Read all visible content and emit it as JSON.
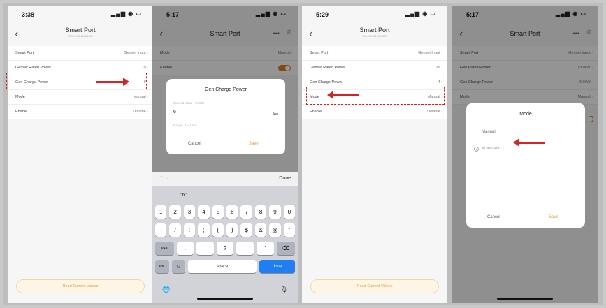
{
  "colors": {
    "accent": "#e07f1f",
    "annotation": "#d42424",
    "done_key": "#1e7ef2"
  },
  "p1": {
    "time": "3:38",
    "status_icons": "▂▄▆ ◉ ▭",
    "title": "Smart Port",
    "subtitle": "SN-4194041005605",
    "rows": [
      {
        "label": "Smart Port",
        "value": "Genset Input"
      },
      {
        "label": "Genset Rated Power",
        "value": "0"
      },
      {
        "label": "Gen Charge Power",
        "value": "0"
      },
      {
        "label": "Mode",
        "value": "Manual"
      },
      {
        "label": "Enable",
        "value": "Disable"
      }
    ],
    "footer": "Read Current Values"
  },
  "p2": {
    "time": "5:17",
    "status_icons": "▂▄▆ ◉ ▭",
    "title": "Smart Port",
    "more": "•••",
    "close": "⊗",
    "bg_rows": [
      {
        "label": "Mode",
        "value": "Manual"
      },
      {
        "label": "Enable",
        "value": ""
      }
    ],
    "dialog": {
      "title": "Gen Charge Power",
      "current": "Current Value - 0.0kW",
      "input": "6",
      "unit": "kw",
      "range": "Range: 0 ~ 16kw",
      "cancel": "Cancel",
      "save": "Save"
    },
    "keyboard": {
      "done": "Done",
      "suggestion": "\"6\"",
      "row1": [
        "1",
        "2",
        "3",
        "4",
        "5",
        "6",
        "7",
        "8",
        "9",
        "0"
      ],
      "row2": [
        "-",
        "/",
        ":",
        ";",
        "(",
        ")",
        "$",
        "&",
        "@",
        "\""
      ],
      "row3_left": "#+=",
      "row3": [
        ".",
        ",",
        "?",
        "!",
        "'"
      ],
      "backspace": "⌫",
      "abc": "ABC",
      "emoji": "☺",
      "space": "space",
      "done_key": "done",
      "globe": "🌐",
      "mic": "🎙"
    }
  },
  "p3": {
    "time": "5:29",
    "status_icons": "▂▄▆ ◉ ▭",
    "title": "Smart Port",
    "subtitle": "SN-4194041005605",
    "rows": [
      {
        "label": "Smart Port",
        "value": "Genset Input"
      },
      {
        "label": "Genset Rated Power",
        "value": "26"
      },
      {
        "label": "Gen Charge Power",
        "value": "4"
      },
      {
        "label": "Mode",
        "value": "Manual"
      },
      {
        "label": "Enable",
        "value": "Disable"
      }
    ],
    "footer": "Read Current Values"
  },
  "p4": {
    "time": "5:17",
    "status_icons": "▂▄▆ ◉ ▭",
    "title": "Smart Port",
    "more": "•••",
    "close": "⊗",
    "bg_rows": [
      {
        "label": "Smart Port",
        "value": "Genset Input"
      },
      {
        "label": "Gen Rated Power",
        "value": "13.0kW"
      },
      {
        "label": "Gen Charge Power",
        "value": "6.0kW"
      },
      {
        "label": "Mode",
        "value": "Manual"
      }
    ],
    "dialog": {
      "title": "Mode",
      "options": [
        "Manual",
        "Automatic"
      ],
      "cancel": "Cancel",
      "save": "Save"
    }
  }
}
